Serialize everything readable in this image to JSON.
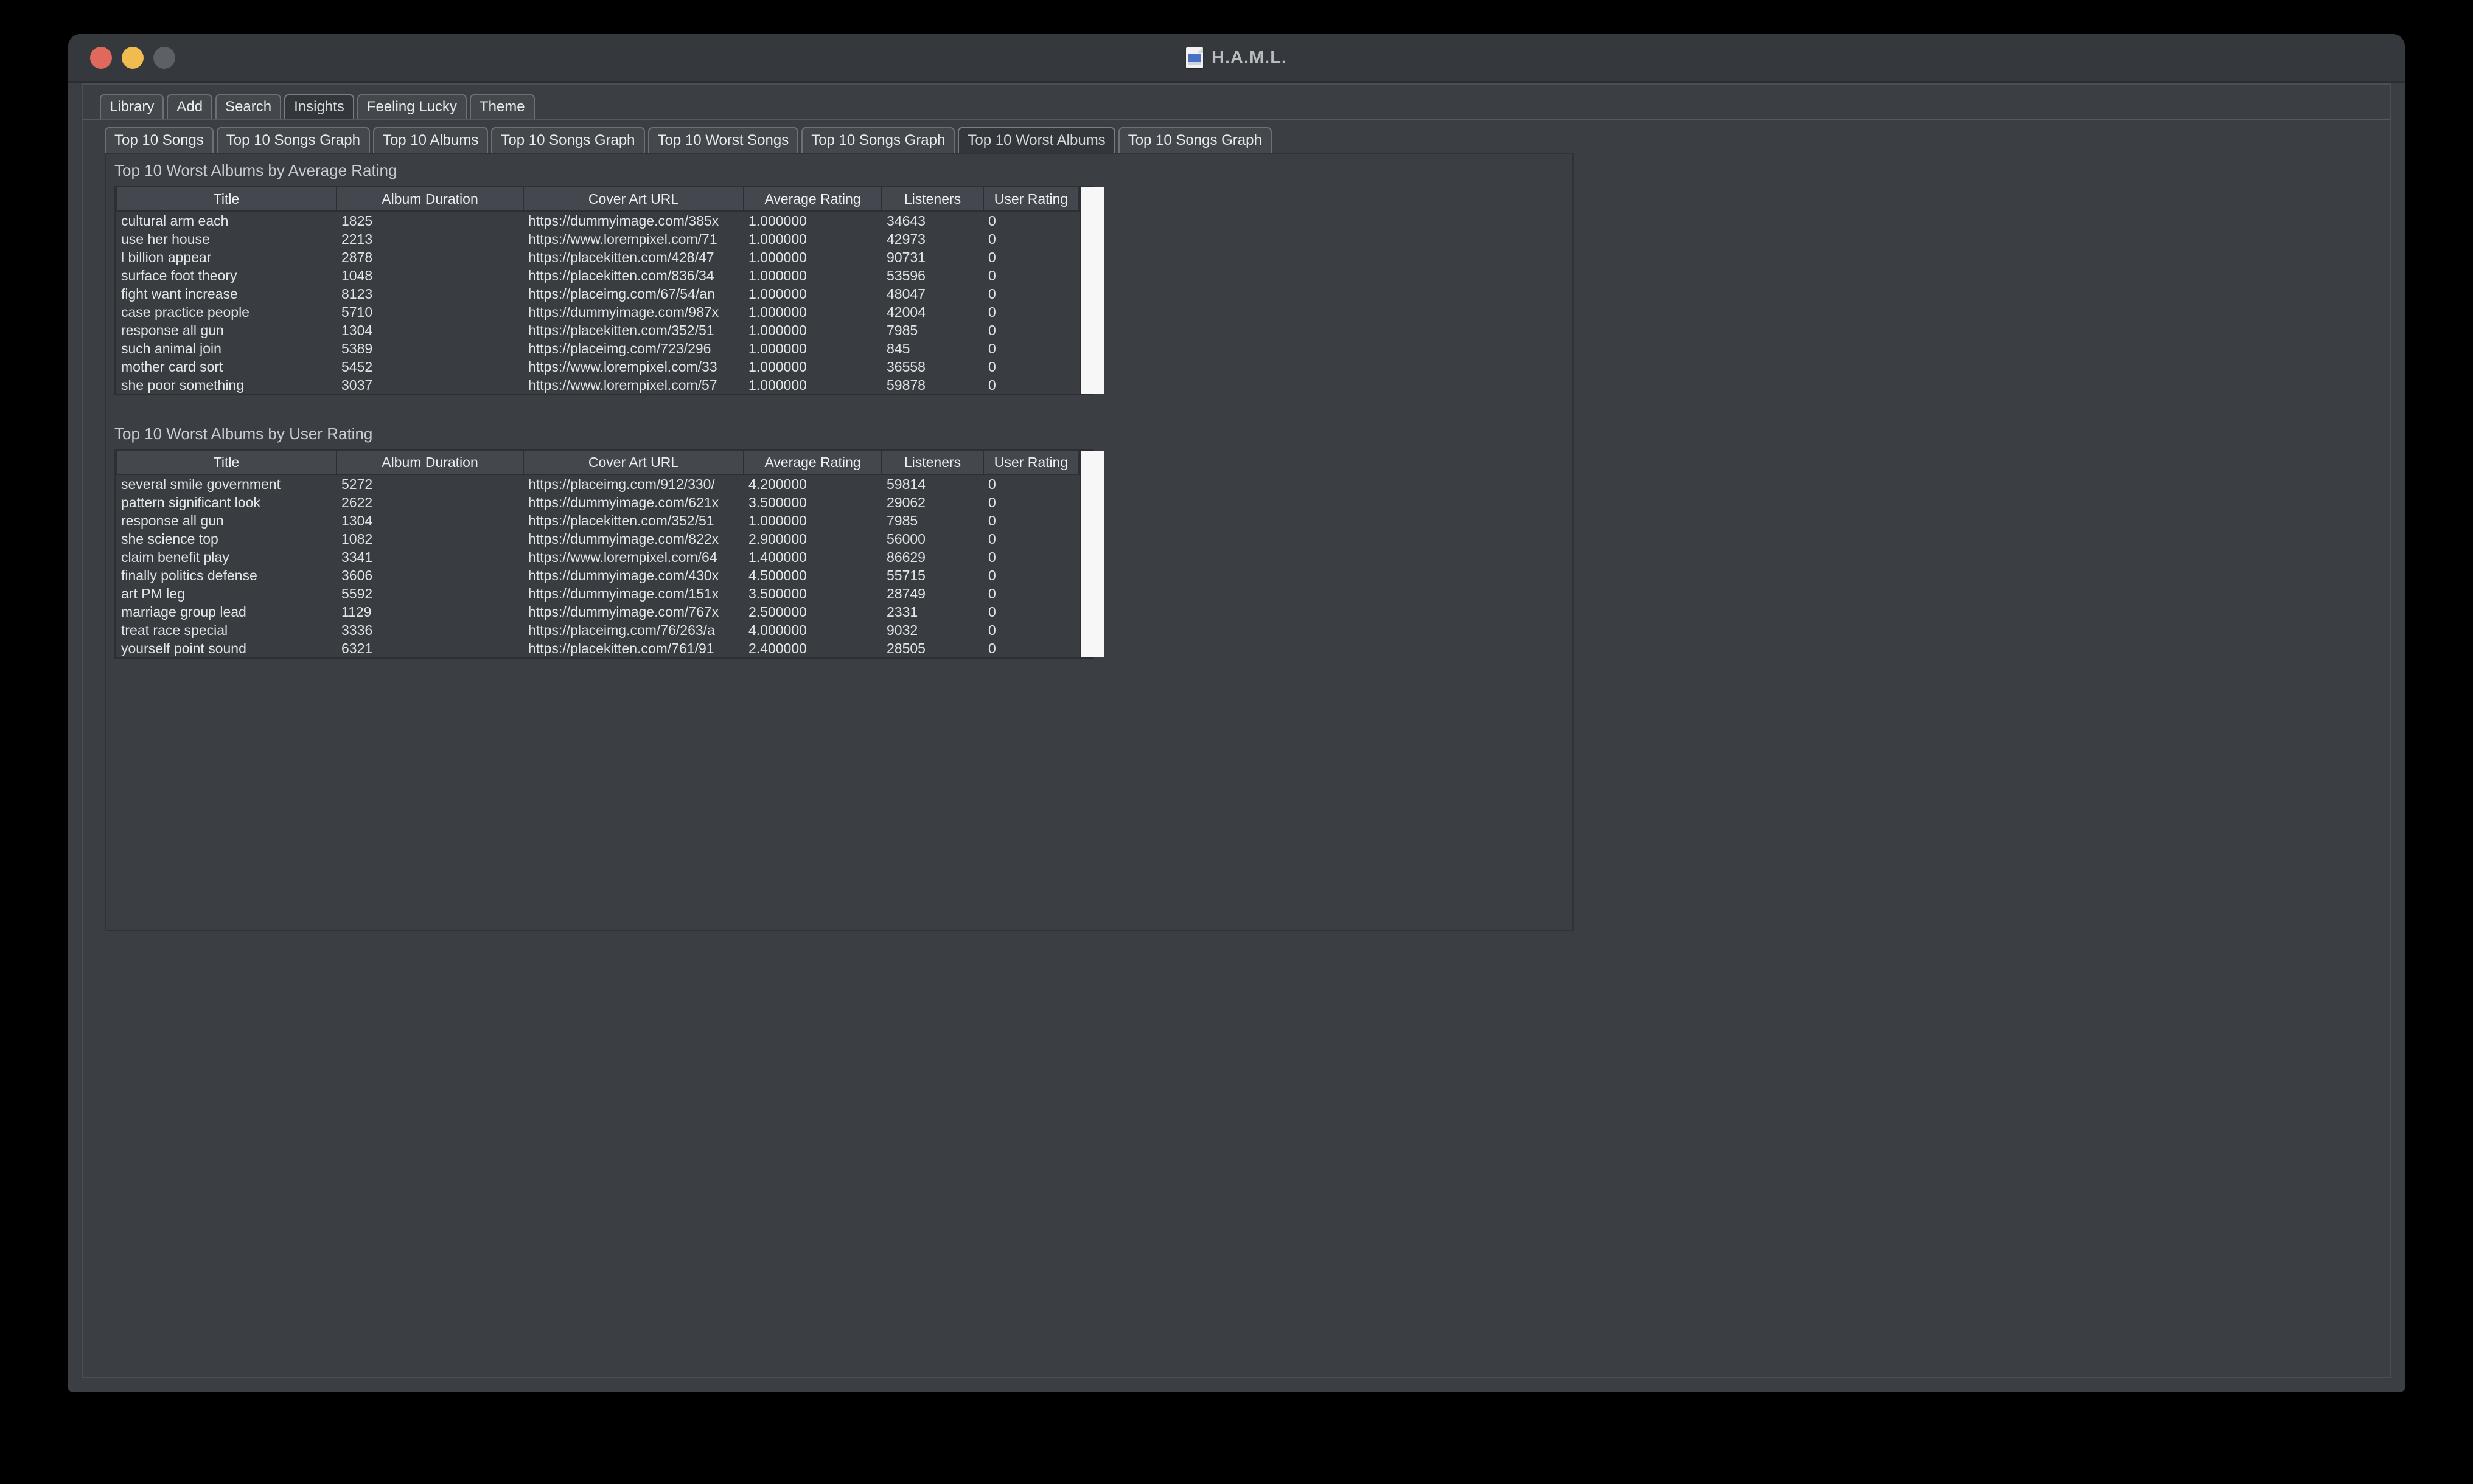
{
  "window": {
    "title": "H.A.M.L.",
    "doc_icon": "document-icon",
    "controls": {
      "close": "close-window-button",
      "minimize": "minimize-window-button",
      "maximize": "maximize-window-button"
    }
  },
  "primary_tabs": [
    {
      "label": "Library",
      "active": false
    },
    {
      "label": "Add",
      "active": false
    },
    {
      "label": "Search",
      "active": false
    },
    {
      "label": "Insights",
      "active": true
    },
    {
      "label": "Feeling Lucky",
      "active": false
    },
    {
      "label": "Theme",
      "active": false
    }
  ],
  "secondary_tabs": [
    {
      "label": "Top 10 Songs",
      "active": false
    },
    {
      "label": "Top 10 Songs Graph",
      "active": false
    },
    {
      "label": "Top 10 Albums",
      "active": false
    },
    {
      "label": "Top 10 Songs Graph",
      "active": false
    },
    {
      "label": "Top 10 Worst Songs",
      "active": false
    },
    {
      "label": "Top 10 Songs Graph",
      "active": false
    },
    {
      "label": "Top 10 Worst Albums",
      "active": true
    },
    {
      "label": "Top 10 Songs Graph",
      "active": false
    }
  ],
  "columns": [
    "Title",
    "Album Duration",
    "Cover Art URL",
    "Average Rating",
    "Listeners",
    "User Rating"
  ],
  "sections": [
    {
      "title": "Top 10 Worst Albums by Average Rating",
      "rows": [
        [
          "cultural arm each",
          "1825",
          "https://dummyimage.com/385x",
          "1.000000",
          "34643",
          "0"
        ],
        [
          "use her house",
          "2213",
          "https://www.lorempixel.com/71",
          "1.000000",
          "42973",
          "0"
        ],
        [
          "l billion appear",
          "2878",
          "https://placekitten.com/428/47",
          "1.000000",
          "90731",
          "0"
        ],
        [
          "surface foot theory",
          "1048",
          "https://placekitten.com/836/34",
          "1.000000",
          "53596",
          "0"
        ],
        [
          "fight want increase",
          "8123",
          "https://placeimg.com/67/54/an",
          "1.000000",
          "48047",
          "0"
        ],
        [
          "case practice people",
          "5710",
          "https://dummyimage.com/987x",
          "1.000000",
          "42004",
          "0"
        ],
        [
          "response all gun",
          "1304",
          "https://placekitten.com/352/51",
          "1.000000",
          "7985",
          "0"
        ],
        [
          "such animal join",
          "5389",
          "https://placeimg.com/723/296",
          "1.000000",
          "845",
          "0"
        ],
        [
          "mother card sort",
          "5452",
          "https://www.lorempixel.com/33",
          "1.000000",
          "36558",
          "0"
        ],
        [
          "she poor something",
          "3037",
          "https://www.lorempixel.com/57",
          "1.000000",
          "59878",
          "0"
        ]
      ]
    },
    {
      "title": "Top 10 Worst Albums by User Rating",
      "rows": [
        [
          "several smile government",
          "5272",
          "https://placeimg.com/912/330/",
          "4.200000",
          "59814",
          "0"
        ],
        [
          "pattern significant look",
          "2622",
          "https://dummyimage.com/621x",
          "3.500000",
          "29062",
          "0"
        ],
        [
          "response all gun",
          "1304",
          "https://placekitten.com/352/51",
          "1.000000",
          "7985",
          "0"
        ],
        [
          "she science top",
          "1082",
          "https://dummyimage.com/822x",
          "2.900000",
          "56000",
          "0"
        ],
        [
          "claim benefit play",
          "3341",
          "https://www.lorempixel.com/64",
          "1.400000",
          "86629",
          "0"
        ],
        [
          "finally politics defense",
          "3606",
          "https://dummyimage.com/430x",
          "4.500000",
          "55715",
          "0"
        ],
        [
          "art PM leg",
          "5592",
          "https://dummyimage.com/151x",
          "3.500000",
          "28749",
          "0"
        ],
        [
          "marriage group lead",
          "1129",
          "https://dummyimage.com/767x",
          "2.500000",
          "2331",
          "0"
        ],
        [
          "treat race special",
          "3336",
          "https://placeimg.com/76/263/a",
          "4.000000",
          "9032",
          "0"
        ],
        [
          "yourself point sound",
          "6321",
          "https://placekitten.com/761/91",
          "2.400000",
          "28505",
          "0"
        ]
      ]
    }
  ],
  "colors": {
    "window_bg": "#3b3f44",
    "titlebar_bg": "#35383d",
    "tab_bg": "#44484d",
    "tab_active_bg": "#33373b",
    "table_bg": "#393d42",
    "header_bg": "#44484e",
    "text": "#e2e4e6",
    "close_button": "#e0695e",
    "minimize_button": "#f0bc4f",
    "maximize_button": "#5d6165",
    "scrollbar": "#f7f7f7"
  }
}
